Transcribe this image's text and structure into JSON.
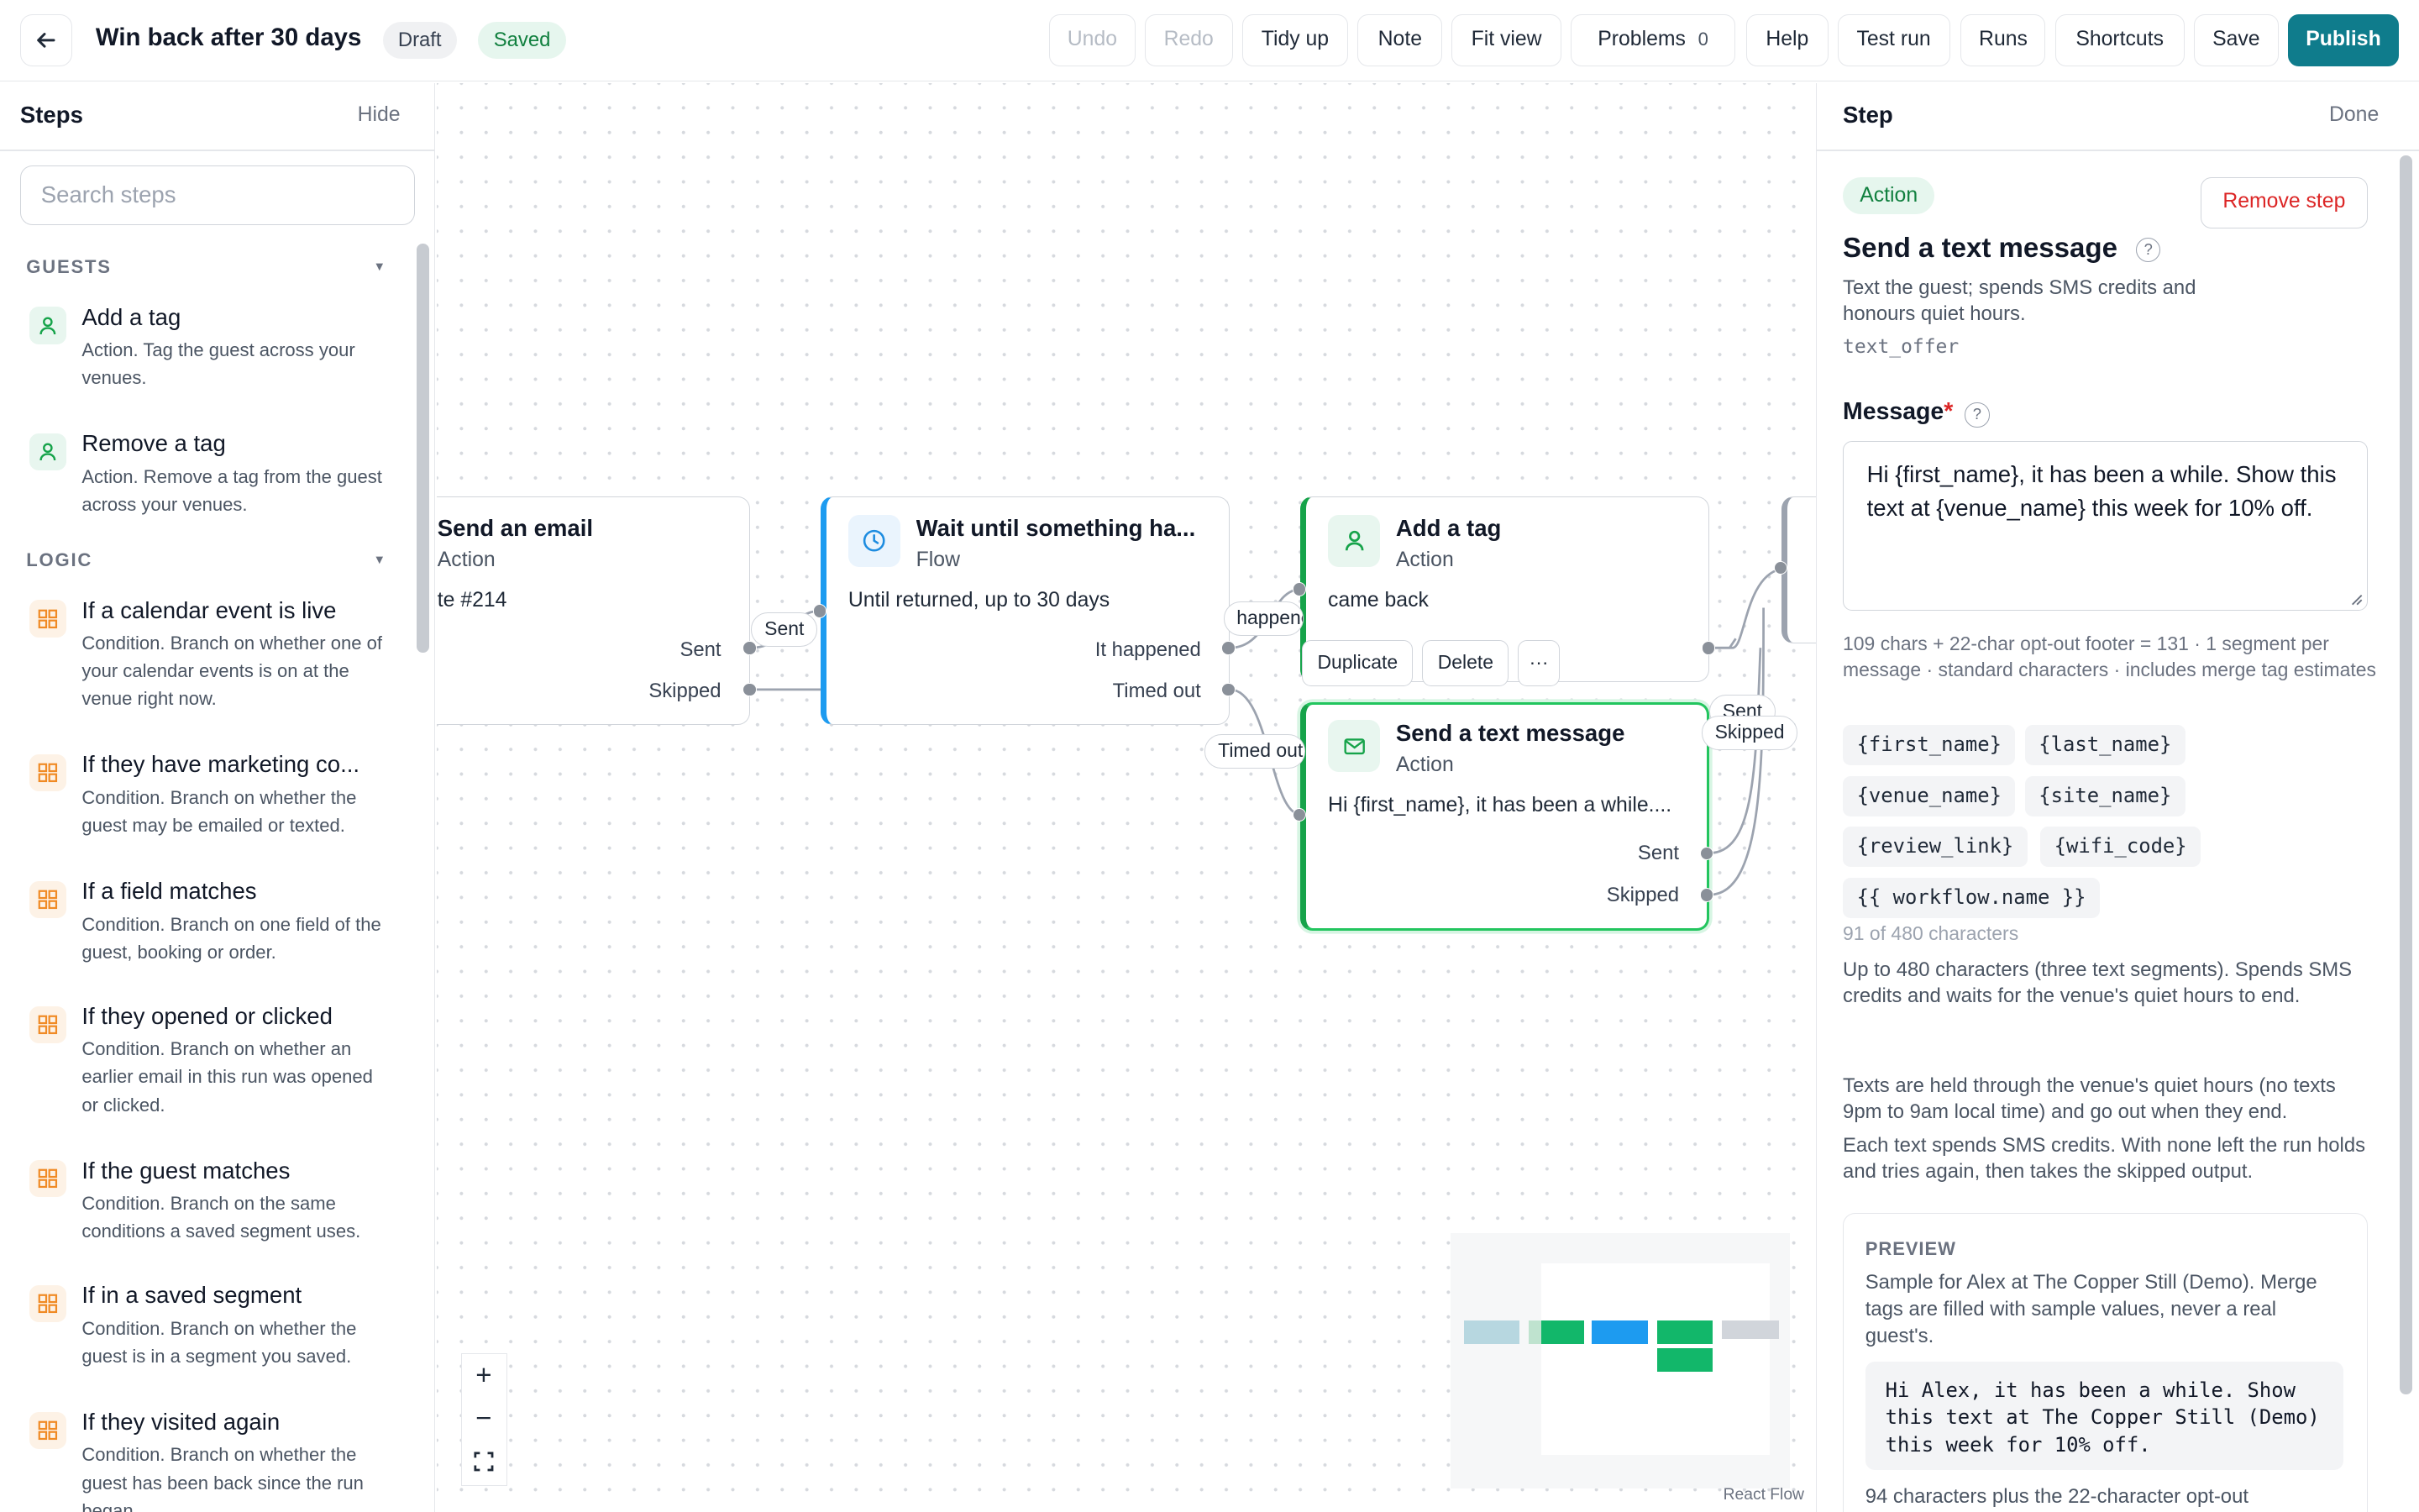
{
  "topbar": {
    "title": "Win back after 30 days",
    "status_draft": "Draft",
    "status_saved": "Saved",
    "buttons": {
      "undo": "Undo",
      "redo": "Redo",
      "tidy_up": "Tidy up",
      "note": "Note",
      "fit_view": "Fit view",
      "problems": "Problems",
      "problems_count": "0",
      "help": "Help",
      "test_run": "Test run",
      "runs": "Runs",
      "shortcuts": "Shortcuts",
      "save": "Save",
      "publish": "Publish"
    },
    "colors": {
      "accent": "#0f7c8c",
      "saved_green": "#11803f"
    }
  },
  "steps_panel": {
    "title": "Steps",
    "hide": "Hide",
    "search_placeholder": "Search steps",
    "sections": [
      {
        "label": "GUESTS",
        "items": [
          {
            "name": "Add a tag",
            "desc": "Action. Tag the guest across your venues.",
            "icon": "person-icon"
          },
          {
            "name": "Remove a tag",
            "desc": "Action. Remove a tag from the guest across your venues.",
            "icon": "person-icon"
          }
        ]
      },
      {
        "label": "LOGIC",
        "items": [
          {
            "name": "If a calendar event is live",
            "desc": "Condition. Branch on whether one of your calendar events is on at the venue right now.",
            "icon": "grid-icon"
          },
          {
            "name": "If they have marketing co...",
            "desc": "Condition. Branch on whether the guest may be emailed or texted.",
            "icon": "grid-icon"
          },
          {
            "name": "If a field matches",
            "desc": "Condition. Branch on one field of the guest, booking or order.",
            "icon": "grid-icon"
          },
          {
            "name": "If they opened or clicked",
            "desc": "Condition. Branch on whether an earlier email in this run was opened or clicked.",
            "icon": "grid-icon"
          },
          {
            "name": "If the guest matches",
            "desc": "Condition. Branch on the same conditions a saved segment uses.",
            "icon": "grid-icon"
          },
          {
            "name": "If in a saved segment",
            "desc": "Condition. Branch on whether the guest is in a segment you saved.",
            "icon": "grid-icon"
          },
          {
            "name": "If they visited again",
            "desc": "Condition. Branch on whether the guest has been back since the run began.",
            "icon": "grid-icon"
          }
        ]
      }
    ]
  },
  "canvas": {
    "nodes": {
      "send_email": {
        "title": "Send an email",
        "type": "Action",
        "body": "te #214",
        "outputs": [
          "Sent",
          "Skipped"
        ]
      },
      "wait": {
        "title": "Wait until something ha...",
        "type": "Flow",
        "body": "Until returned, up to 30 days",
        "outputs": [
          "It happened",
          "Timed out"
        ],
        "icon": "clock-icon"
      },
      "add_tag": {
        "title": "Add a tag",
        "type": "Action",
        "body": "came back",
        "icon": "person-icon"
      },
      "send_text": {
        "title": "Send a text message",
        "type": "Action",
        "body": "Hi {first_name}, it has been a while....",
        "outputs": [
          "Sent",
          "Skipped"
        ],
        "icon": "mail-icon"
      }
    },
    "edge_labels": {
      "sent1": "Sent",
      "happened": "happened",
      "timed_out": "Timed out",
      "sent2": "Sent",
      "skipped2": "Skipped"
    },
    "node_toolbar": {
      "duplicate": "Duplicate",
      "delete": "Delete",
      "more": "···"
    },
    "zoom": {
      "in": "+",
      "out": "−",
      "fit": "fit-icon"
    },
    "attribution": "React Flow"
  },
  "step_panel": {
    "title": "Step",
    "done": "Done",
    "badge": "Action",
    "remove": "Remove step",
    "step_title": "Send a text message",
    "desc": "Text the guest; spends SMS credits and honours quiet hours.",
    "key": "text_offer",
    "message_label": "Message",
    "required_mark": "*",
    "message_value": "Hi {first_name}, it has been a while. Show this text at {venue_name} this week for 10% off.",
    "meta": "109 chars + 22-char opt-out footer = 131 · 1 segment per message · standard characters · includes merge tag estimates",
    "merge_tags": [
      "{first_name}",
      "{last_name}",
      "{venue_name}",
      "{site_name}",
      "{review_link}",
      "{wifi_code}",
      "{{ workflow.name }}"
    ],
    "char_count": "91 of 480 characters",
    "limit_help": "Up to 480 characters (three text segments). Spends SMS credits and waits for the venue's quiet hours to end.",
    "quiet_hours": "Texts are held through the venue's quiet hours (no texts 9pm to 9am local time) and go out when they end.",
    "credits": "Each text spends SMS credits. With none left the run holds and tries again, then takes the skipped output.",
    "preview": {
      "label": "PREVIEW",
      "desc": "Sample for Alex at The Copper Still (Demo). Merge tags are filled with sample values, never a real guest's.",
      "text": "Hi Alex, it has been a while. Show\nthis text at The Copper Still (Demo)\nthis week for 10% off.",
      "footer": "94 characters plus the 22-character opt-out"
    }
  }
}
